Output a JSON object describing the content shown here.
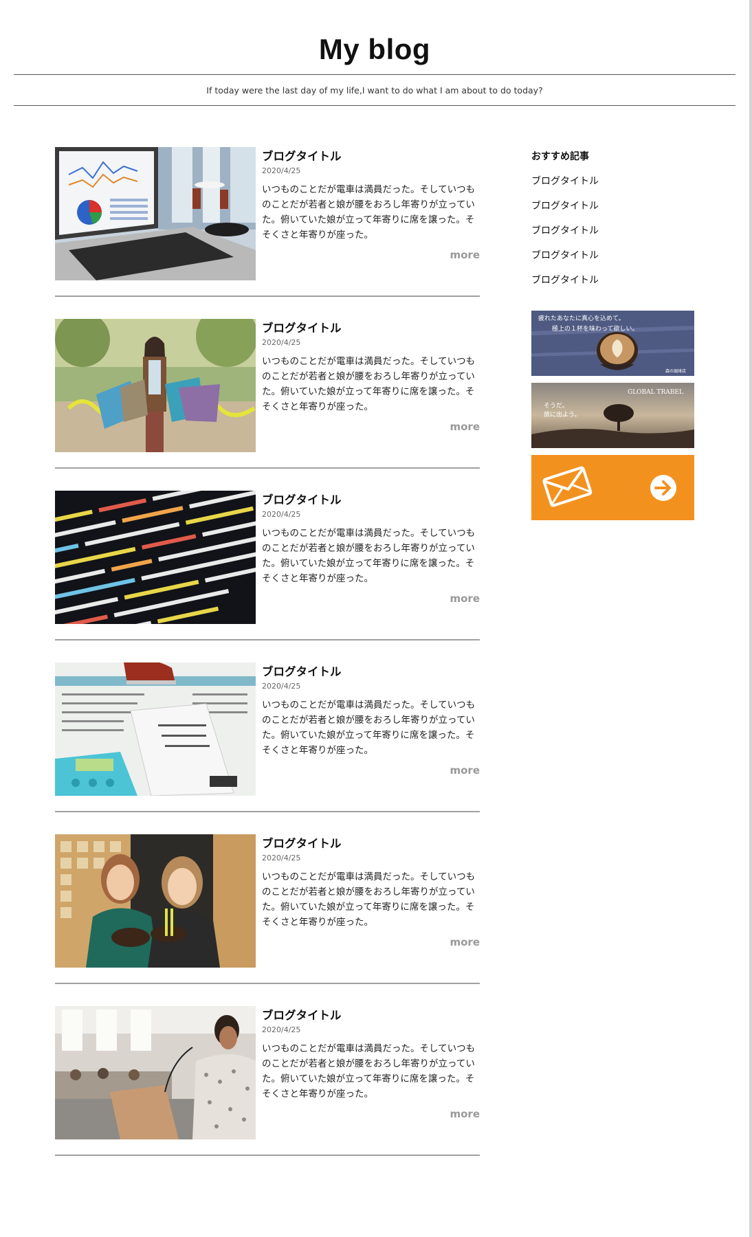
{
  "site": {
    "title": "My blog",
    "tagline": "If today were the last day of my life,I want to do what I am about to do today?"
  },
  "posts": [
    {
      "title": "ブログタイトル",
      "date": "2020/4/25",
      "excerpt": "いつものことだが電車は満員だった。そしていつものことだが若者と娘が腰をおろし年寄りが立っていた。俯いていた娘が立って年寄りに席を譲った。そそくさと年寄りが座った。",
      "more": "more",
      "image": "laptop-office-photo"
    },
    {
      "title": "ブログタイトル",
      "date": "2020/4/25",
      "excerpt": "いつものことだが電車は満員だった。そしていつものことだが若者と娘が腰をおろし年寄りが立っていた。俯いていた娘が立って年寄りに席を譲った。そそくさと年寄りが座った。",
      "more": "more",
      "image": "shopping-woman-photo"
    },
    {
      "title": "ブログタイトル",
      "date": "2020/4/25",
      "excerpt": "いつものことだが電車は満員だった。そしていつものことだが若者と娘が腰をおろし年寄りが立っていた。俯いていた娘が立って年寄りに席を譲った。そそくさと年寄りが座った。",
      "more": "more",
      "image": "source-code-photo"
    },
    {
      "title": "ブログタイトル",
      "date": "2020/4/25",
      "excerpt": "いつものことだが電車は満員だった。そしていつものことだが若者と娘が腰をおろし年寄りが立っていた。俯いていた娘が立って年寄りに席を譲った。そそくさと年寄りが座った。",
      "more": "more",
      "image": "household-budget-photo"
    },
    {
      "title": "ブログタイトル",
      "date": "2020/4/25",
      "excerpt": "いつものことだが電車は満員だった。そしていつものことだが若者と娘が腰をおろし年寄りが立っていた。俯いていた娘が立って年寄りに席を譲った。そそくさと年寄りが座った。",
      "more": "more",
      "image": "women-eating-noodles-photo"
    },
    {
      "title": "ブログタイトル",
      "date": "2020/4/25",
      "excerpt": "いつものことだが電車は満員だった。そしていつものことだが若者と娘が腰をおろし年寄りが立っていた。俯いていた娘が立って年寄りに席を譲った。そそくさと年寄りが座った。",
      "more": "more",
      "image": "woman-presenting-photo"
    }
  ],
  "sidebar": {
    "heading": "おすすめ記事",
    "items": [
      "ブログタイトル",
      "ブログタイトル",
      "ブログタイトル",
      "ブログタイトル",
      "ブログタイトル"
    ],
    "banners": {
      "coffee": {
        "line1": "疲れたあなたに真心を込めて。",
        "line2": "極上の１杯を味わって欲しい。",
        "credit": "森の珈琲店"
      },
      "travel": {
        "title": "GLOBAL TRABEL",
        "line1": "そうだ。",
        "line2": "旅に出よう。"
      },
      "contact": {
        "icon": "envelope-icon",
        "arrow": "arrow-right-circle-icon"
      }
    }
  },
  "colors": {
    "accent_orange": "#f3911f",
    "divider": "#a0a0a0",
    "more_text": "#999999"
  }
}
